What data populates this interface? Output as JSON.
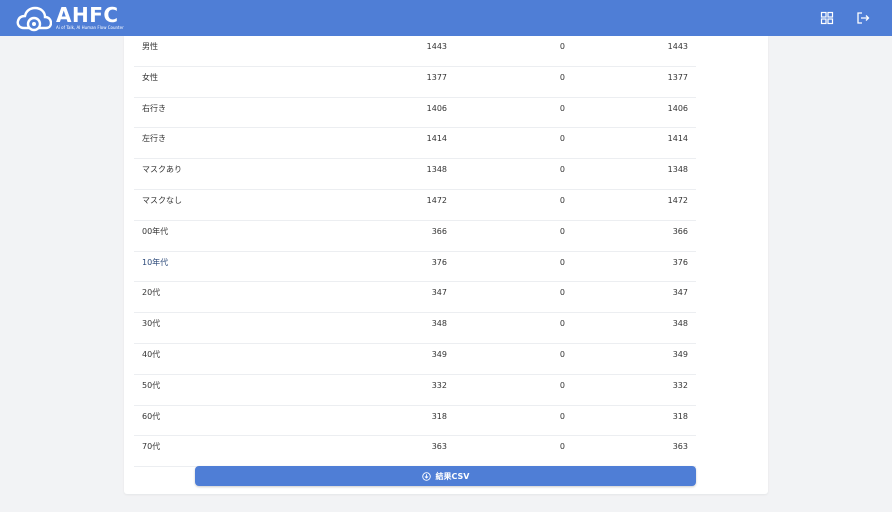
{
  "header": {
    "logo_text": "AHFC",
    "logo_subtext": "Ai of Talk, AI Human Flow Counter",
    "icons": [
      "grid-icon",
      "logout-icon"
    ],
    "color": "#4f7ed6"
  },
  "table": {
    "rows": [
      {
        "label": "男性",
        "a": "1443",
        "b": "0",
        "c": "1443"
      },
      {
        "label": "女性",
        "a": "1377",
        "b": "0",
        "c": "1377"
      },
      {
        "label": "右行き",
        "a": "1406",
        "b": "0",
        "c": "1406"
      },
      {
        "label": "左行き",
        "a": "1414",
        "b": "0",
        "c": "1414"
      },
      {
        "label": "マスクあり",
        "a": "1348",
        "b": "0",
        "c": "1348"
      },
      {
        "label": "マスクなし",
        "a": "1472",
        "b": "0",
        "c": "1472"
      },
      {
        "label": "00年代",
        "a": "366",
        "b": "0",
        "c": "366"
      },
      {
        "label": "10年代",
        "a": "376",
        "b": "0",
        "c": "376"
      },
      {
        "label": "20代",
        "a": "347",
        "b": "0",
        "c": "347"
      },
      {
        "label": "30代",
        "a": "348",
        "b": "0",
        "c": "348"
      },
      {
        "label": "40代",
        "a": "349",
        "b": "0",
        "c": "349"
      },
      {
        "label": "50代",
        "a": "332",
        "b": "0",
        "c": "332"
      },
      {
        "label": "60代",
        "a": "318",
        "b": "0",
        "c": "318"
      },
      {
        "label": "70代",
        "a": "363",
        "b": "0",
        "c": "363"
      }
    ]
  },
  "csv_button": {
    "label": "結果CSV",
    "icon": "download-circle-icon"
  }
}
